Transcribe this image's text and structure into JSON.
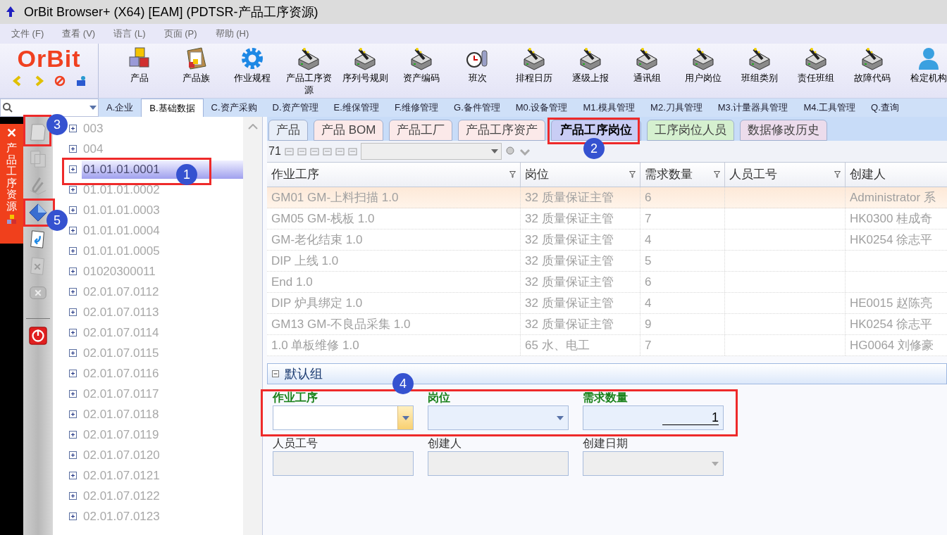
{
  "window": {
    "title": "OrBit Browser+ (X64) [EAM] (PDTSR-产品工序资源)"
  },
  "menu": [
    "文件 (F)",
    "查看 (V)",
    "语言 (L)",
    "页面 (P)",
    "帮助 (H)"
  ],
  "toolbar": [
    {
      "label": "产品"
    },
    {
      "label": "产品族"
    },
    {
      "label": "作业规程"
    },
    {
      "label": "产品工序资源"
    },
    {
      "label": "序列号规则"
    },
    {
      "label": "资产编码"
    },
    {
      "label": "班次"
    },
    {
      "label": "排程日历"
    },
    {
      "label": "逐级上报"
    },
    {
      "label": "通讯组"
    },
    {
      "label": "用户岗位"
    },
    {
      "label": "班组类别"
    },
    {
      "label": "责任班组"
    },
    {
      "label": "故障代码"
    },
    {
      "label": "检定机构"
    }
  ],
  "logo": "OrBit",
  "modules": [
    {
      "label": "A.企业",
      "selected": false
    },
    {
      "label": "B.基础数据",
      "selected": true
    },
    {
      "label": "C.资产采购",
      "selected": false
    },
    {
      "label": "D.资产管理",
      "selected": false
    },
    {
      "label": "E.维保管理",
      "selected": false
    },
    {
      "label": "F.维修管理",
      "selected": false
    },
    {
      "label": "G.备件管理",
      "selected": false
    },
    {
      "label": "M0.设备管理",
      "selected": false
    },
    {
      "label": "M1.模具管理",
      "selected": false
    },
    {
      "label": "M2.刀具管理",
      "selected": false
    },
    {
      "label": "M3.计量器具管理",
      "selected": false
    },
    {
      "label": "M4.工具管理",
      "selected": false
    },
    {
      "label": "Q.查询",
      "selected": false
    }
  ],
  "side_tab": {
    "label": "产品工序资源",
    "close": "✕"
  },
  "tree": [
    {
      "label": "003",
      "selected": false
    },
    {
      "label": "004",
      "selected": false
    },
    {
      "label": "01.01.01.0001",
      "selected": true
    },
    {
      "label": "01.01.01.0002",
      "selected": false
    },
    {
      "label": "01.01.01.0003",
      "selected": false
    },
    {
      "label": "01.01.01.0004",
      "selected": false
    },
    {
      "label": "01.01.01.0005",
      "selected": false
    },
    {
      "label": "01020300011",
      "selected": false
    },
    {
      "label": "02.01.07.0112",
      "selected": false
    },
    {
      "label": "02.01.07.0113",
      "selected": false
    },
    {
      "label": "02.01.07.0114",
      "selected": false
    },
    {
      "label": "02.01.07.0115",
      "selected": false
    },
    {
      "label": "02.01.07.0116",
      "selected": false
    },
    {
      "label": "02.01.07.0117",
      "selected": false
    },
    {
      "label": "02.01.07.0118",
      "selected": false
    },
    {
      "label": "02.01.07.0119",
      "selected": false
    },
    {
      "label": "02.01.07.0120",
      "selected": false
    },
    {
      "label": "02.01.07.0121",
      "selected": false
    },
    {
      "label": "02.01.07.0122",
      "selected": false
    },
    {
      "label": "02.01.07.0123",
      "selected": false
    }
  ],
  "tabs": [
    {
      "label": "产品",
      "selected": false,
      "color": "#e8eef8"
    },
    {
      "label": "产品 BOM",
      "selected": false,
      "color": "#fbe9e9"
    },
    {
      "label": "产品工厂",
      "selected": false,
      "color": "#fbe9e9"
    },
    {
      "label": "产品工序资产",
      "selected": false,
      "color": "#fbe9e9"
    },
    {
      "label": "产品工序岗位",
      "selected": true,
      "color": "#c9cdf5"
    },
    {
      "label": "工序岗位人员",
      "selected": false,
      "color": "#d5f0cf"
    },
    {
      "label": "数据修改历史",
      "selected": false,
      "color": "#ecdcec"
    }
  ],
  "grid_toolbar": {
    "count": "71"
  },
  "table": {
    "columns": [
      "作业工序",
      "岗位",
      "需求数量",
      "人员工号",
      "创建人"
    ],
    "rows": [
      {
        "cells": [
          "GM01 GM-上料扫描 1.0",
          "32 质量保证主管",
          "6",
          "",
          "Administrator 系"
        ],
        "selected": true
      },
      {
        "cells": [
          "GM05 GM-栈板 1.0",
          "32 质量保证主管",
          "7",
          "",
          "HK0300 桂成奇"
        ],
        "selected": false
      },
      {
        "cells": [
          "GM-老化结束 1.0",
          "32 质量保证主管",
          "4",
          "",
          "HK0254 徐志平"
        ],
        "selected": false
      },
      {
        "cells": [
          "DIP 上线 1.0",
          "32 质量保证主管",
          "5",
          "",
          ""
        ],
        "selected": false
      },
      {
        "cells": [
          "End 1.0",
          "32 质量保证主管",
          "6",
          "",
          ""
        ],
        "selected": false
      },
      {
        "cells": [
          "DIP 炉具绑定 1.0",
          "32 质量保证主管",
          "4",
          "",
          "HE0015 赵陈亮"
        ],
        "selected": false
      },
      {
        "cells": [
          "GM13 GM-不良品采集 1.0",
          "32 质量保证主管",
          "9",
          "",
          "HK0254 徐志平"
        ],
        "selected": false
      },
      {
        "cells": [
          "1.0 单板维修 1.0",
          "65 水、电工",
          "7",
          "",
          "HG0064 刘修豪"
        ],
        "selected": false
      }
    ]
  },
  "group": {
    "title": "默认组",
    "expanded": true
  },
  "form": [
    {
      "label": "作业工序",
      "kind": "combo",
      "required": true,
      "disabled": false,
      "focused": true
    },
    {
      "label": "岗位",
      "kind": "combo",
      "required": true,
      "disabled": false,
      "focused": false
    },
    {
      "label": "需求数量",
      "kind": "masked",
      "required": true,
      "disabled": false,
      "value": "1"
    },
    {
      "label": "人员工号",
      "kind": "text",
      "required": false,
      "disabled": true
    },
    {
      "label": "创建人",
      "kind": "text",
      "required": false,
      "disabled": true
    },
    {
      "label": "创建日期",
      "kind": "combo",
      "required": false,
      "disabled": true,
      "focused": false
    }
  ],
  "callouts": [
    "1",
    "2",
    "3",
    "4",
    "5"
  ]
}
